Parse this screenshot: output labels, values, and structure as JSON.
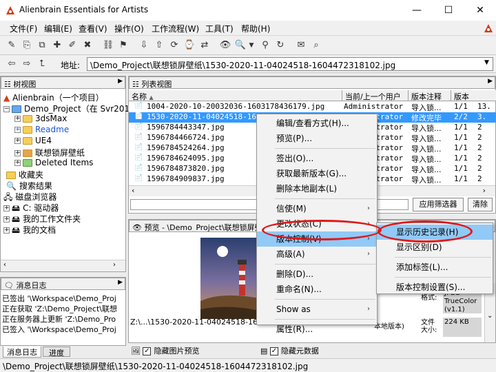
{
  "window": {
    "title": "Alienbrain Essentials for Artists",
    "min": "—",
    "max": "☐",
    "close": "✕"
  },
  "menubar": [
    "文件(F)",
    "编辑(E)",
    "查看(V)",
    "操作(O)",
    "工作流程(W)",
    "工具(T)",
    "帮助(H)"
  ],
  "address": {
    "label": "地址:",
    "value": "\\Demo_Project\\联想锁屏壁纸\\1530-2020-11-04024518-1604472318102.jpg"
  },
  "tree": {
    "header": "树视图",
    "items": [
      "Alienbrain（一个项目）",
      "Demo_Project（在 Svr2012",
      "3dsMax",
      "Readme",
      "UE4",
      "联想锁屏壁纸",
      "Deleted Items",
      "收藏夹",
      "搜索结果",
      "磁盘浏览器",
      "C: 驱动器",
      "我的工作文件夹",
      "我的文档"
    ]
  },
  "log": {
    "header": "消息日志",
    "lines": [
      "已签出 '\\Workspace\\Demo_Proj",
      "正在获取 'Z:\\Demo_Project\\联想",
      "正在服务器上更新 'Z:\\Demo_Pro",
      "已签入 '\\Workspace\\Demo_Proj"
    ],
    "tabs": [
      "消息日志",
      "进度"
    ]
  },
  "list": {
    "header": "列表视图",
    "columns": [
      "名称",
      "当前/上一个用户",
      "版本注释",
      "版本"
    ],
    "rows": [
      {
        "name": "1004-2020-10-20032036-1603178436179.jpg",
        "user": "Administrator",
        "note": "导入锁...",
        "ver": "1/1",
        "extra": "13."
      },
      {
        "name": "1530-2020-11-04024518-1604472318102.jpg",
        "user": "Administrator",
        "note": "修改完毕",
        "ver": "2/2",
        "extra": "3."
      },
      {
        "name": "1596784443347.jpg",
        "user": "Administrator",
        "note": "导入锁...",
        "ver": "1/1",
        "extra": "2"
      },
      {
        "name": "1596784466724.jpg",
        "user": "Administrator",
        "note": "导入锁...",
        "ver": "1/1",
        "extra": "2"
      },
      {
        "name": "1596784524264.jpg",
        "user": "Administrator",
        "note": "导入锁...",
        "ver": "1/1",
        "extra": "2"
      },
      {
        "name": "1596784624095.jpg",
        "user": "Administrator",
        "note": "导入锁...",
        "ver": "1/1",
        "extra": "2"
      },
      {
        "name": "1596784873820.jpg",
        "user": "Administrator",
        "note": "导入锁...",
        "ver": "1/1",
        "extra": "2"
      },
      {
        "name": "1596784909837.jpg",
        "user": "Administrator",
        "note": "导入锁...",
        "ver": "1/1",
        "extra": "2"
      }
    ],
    "apply_filter": "应用筛选器",
    "clear": "清除"
  },
  "preview": {
    "header": "预览 - \\Demo_Project\\联想锁屏壁",
    "file": "Z:\\...\\1530-2020-11-04024518-16044723",
    "props": [
      {
        "k": "格式:",
        "v": "JPEG TrueColor (v1.1)"
      },
      {
        "k": "文件大小:",
        "v": "224 KB"
      }
    ],
    "local_version": "本地版本)",
    "hide_preview": "隐藏图片预览",
    "hide_meta": "隐藏元数据"
  },
  "context_menu": {
    "items": [
      {
        "label": "编辑/查看方式(H)...",
        "sub": false
      },
      {
        "label": "预览(P)...",
        "sub": false
      },
      {
        "sep": true
      },
      {
        "label": "签出(O)...",
        "sub": false
      },
      {
        "label": "获取最新版本(G)...",
        "sub": false
      },
      {
        "label": "删除本地副本(L)",
        "sub": false
      },
      {
        "sep": true
      },
      {
        "label": "信使(M)",
        "sub": true
      },
      {
        "label": "更改状态(C)",
        "sub": true
      },
      {
        "label": "版本控制(V)",
        "sub": true,
        "hi": true
      },
      {
        "label": "高级(A)",
        "sub": true
      },
      {
        "sep": true
      },
      {
        "label": "删除(D)...",
        "sub": false
      },
      {
        "label": "重命名(N)...",
        "sub": false
      },
      {
        "sep": true
      },
      {
        "label": "Show as",
        "sub": true
      },
      {
        "sep": true
      },
      {
        "label": "属性(R)...",
        "sub": false
      }
    ]
  },
  "submenu": {
    "items": [
      {
        "label": "显示历史记录(H)",
        "hi": true
      },
      {
        "label": "显示区别(D)"
      },
      {
        "sep": true
      },
      {
        "label": "添加标签(L)..."
      },
      {
        "sep": true
      },
      {
        "label": "版本控制设置(S)..."
      }
    ]
  },
  "statusbar": "\\Demo_Project\\联想锁屏壁纸\\1530-2020-11-04024518-1604472318102.jpg",
  "colors": {
    "accent": "#3399ff",
    "ring": "#e01818",
    "highlight": "#91c9f7"
  }
}
